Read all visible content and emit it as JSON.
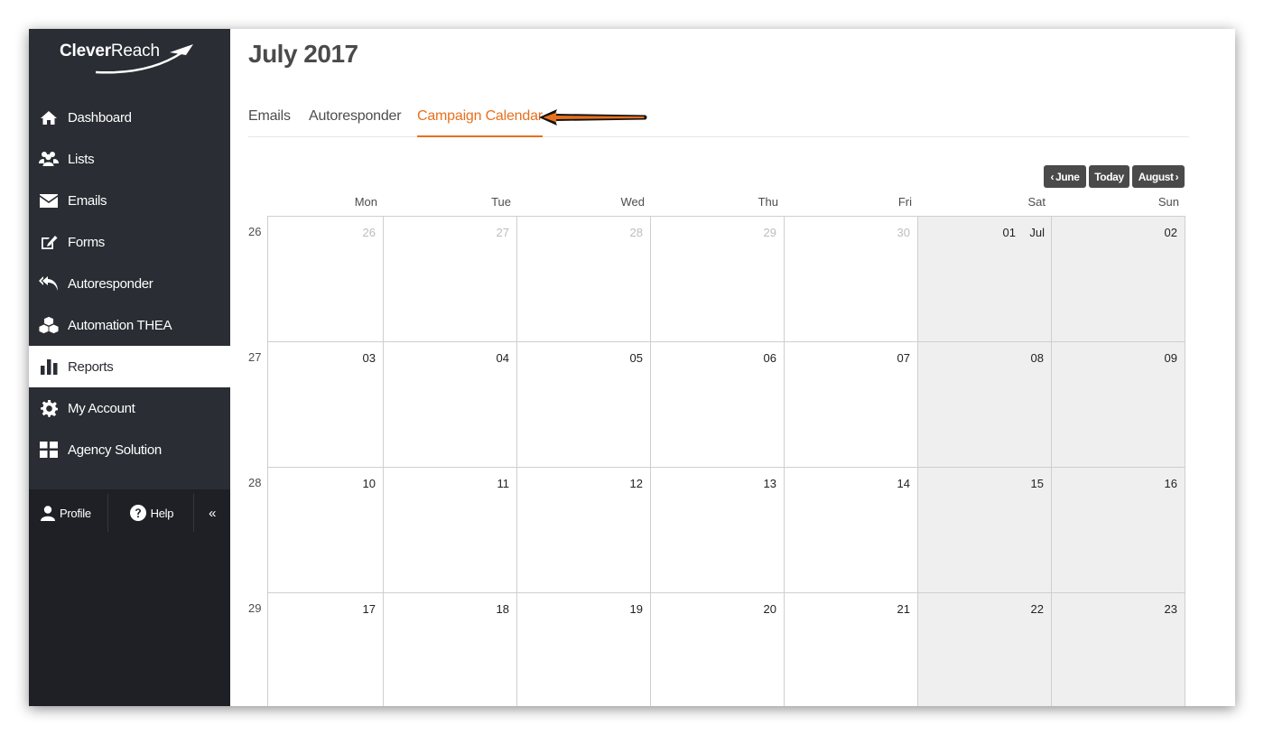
{
  "brand": {
    "name_bold": "Clever",
    "name_light": "Reach"
  },
  "sidebar": {
    "items": [
      {
        "label": "Dashboard",
        "icon": "home-icon"
      },
      {
        "label": "Lists",
        "icon": "users-icon"
      },
      {
        "label": "Emails",
        "icon": "envelope-icon"
      },
      {
        "label": "Forms",
        "icon": "edit-icon"
      },
      {
        "label": "Autoresponder",
        "icon": "reply-all-icon"
      },
      {
        "label": "Automation THEA",
        "icon": "cubes-icon"
      },
      {
        "label": "Reports",
        "icon": "bar-chart-icon"
      },
      {
        "label": "My Account",
        "icon": "gear-icon"
      },
      {
        "label": "Agency Solution",
        "icon": "grid-icon"
      }
    ],
    "active_index": 6,
    "footer": {
      "profile": "Profile",
      "help": "Help",
      "collapse": "«"
    }
  },
  "header": {
    "title": "July 2017"
  },
  "tabs": [
    "Emails",
    "Autoresponder",
    "Campaign Calendar"
  ],
  "active_tab": 2,
  "calendar": {
    "prev_label": "June",
    "today_label": "Today",
    "next_label": "August",
    "day_names": [
      "Mon",
      "Tue",
      "Wed",
      "Thu",
      "Fri",
      "Sat",
      "Sun"
    ],
    "weeks": [
      {
        "number": "26",
        "days": [
          "26",
          "27",
          "28",
          "29",
          "30",
          "01",
          "02"
        ],
        "other_month": [
          true,
          true,
          true,
          true,
          true,
          false,
          false
        ],
        "month_label": "Jul",
        "month_label_index": 5
      },
      {
        "number": "27",
        "days": [
          "03",
          "04",
          "05",
          "06",
          "07",
          "08",
          "09"
        ]
      },
      {
        "number": "28",
        "days": [
          "10",
          "11",
          "12",
          "13",
          "14",
          "15",
          "16"
        ]
      },
      {
        "number": "29",
        "days": [
          "17",
          "18",
          "19",
          "20",
          "21",
          "22",
          "23"
        ]
      }
    ]
  },
  "colors": {
    "accent": "#e8701e",
    "sidebar_dark": "#1e2025",
    "sidebar": "#2a2d33",
    "weekend": "#efefef",
    "button": "#4a4a4a"
  }
}
